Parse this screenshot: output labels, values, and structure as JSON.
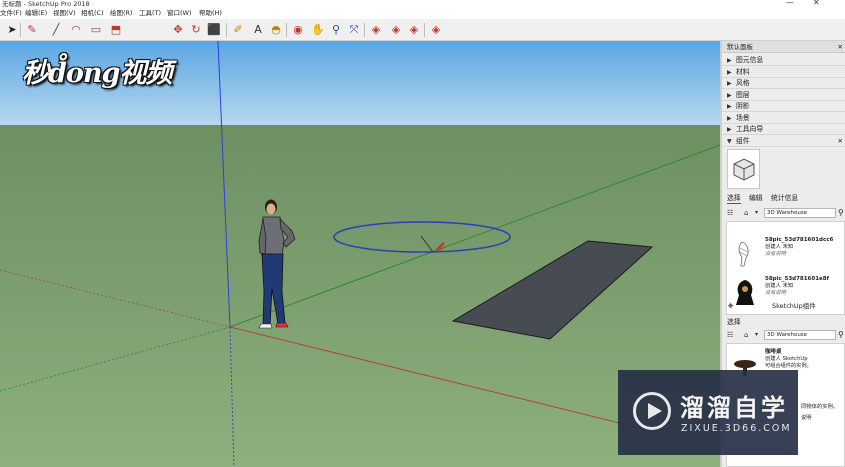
{
  "window": {
    "title": "无标题 - SketchUp Pro 2018",
    "min_glyph": "—",
    "close_glyph": "✕"
  },
  "menu": [
    "文件(F)",
    "编辑(E)",
    "视图(V)",
    "相机(C)",
    "绘图(R)",
    "工具(T)",
    "窗口(W)",
    "帮助(H)"
  ],
  "toolbar": {
    "icons": [
      {
        "name": "select-arrow-icon",
        "glyph": "➤",
        "color": "#222222"
      },
      {
        "name": "eraser-icon",
        "glyph": "✎",
        "color": "#c0392b"
      },
      {
        "name": "line-icon",
        "glyph": "╱",
        "color": "#444444"
      },
      {
        "name": "arc-icon",
        "glyph": "◠",
        "color": "#b03a2e"
      },
      {
        "name": "rectangle-icon",
        "glyph": "▭",
        "color": "#b03a2e"
      },
      {
        "name": "push-pull-icon",
        "glyph": "⬒",
        "color": "#c0392b"
      },
      {
        "name": "move-icon",
        "glyph": "✥",
        "color": "#c0392b"
      },
      {
        "name": "rotate-icon",
        "glyph": "↻",
        "color": "#c0392b"
      },
      {
        "name": "scale-icon",
        "glyph": "⬛",
        "color": "#b03a2e"
      },
      {
        "name": "tape-measure-icon",
        "glyph": "✐",
        "color": "#b8860b"
      },
      {
        "name": "text-icon",
        "glyph": "A",
        "color": "#333333"
      },
      {
        "name": "paint-bucket-icon",
        "glyph": "◓",
        "color": "#b8860b"
      },
      {
        "name": "orbit-icon",
        "glyph": "◉",
        "color": "#c0392b"
      },
      {
        "name": "pan-icon",
        "glyph": "✋",
        "color": "#b8860b"
      },
      {
        "name": "zoom-icon",
        "glyph": "⚲",
        "color": "#1f4f9f"
      },
      {
        "name": "zoom-extents-icon",
        "glyph": "⤧",
        "color": "#1f4f9f"
      },
      {
        "name": "warehouse-icon",
        "glyph": "◈",
        "color": "#c0392b"
      },
      {
        "name": "extension-warehouse-icon",
        "glyph": "◈",
        "color": "#c0392b"
      },
      {
        "name": "share-model-icon",
        "glyph": "◈",
        "color": "#c0392b"
      },
      {
        "name": "extension-manager-icon",
        "glyph": "◈",
        "color": "#c0392b"
      }
    ]
  },
  "watermark": {
    "top_left": "秒d̊ong视频",
    "brand_cn": "溜溜自学",
    "brand_url": "ZIXUE.3D66.COM"
  },
  "colors": {
    "sky": "#6aaee0",
    "ground": "#7b9e6d",
    "axis_red": "#b6402f",
    "axis_green": "#2e8b2e",
    "axis_blue": "#2f3fd8",
    "rectangle_fill": "#474c52"
  },
  "tray": {
    "title": "默认面板",
    "close": "✕",
    "sections": [
      {
        "label": "图元信息",
        "expanded": false
      },
      {
        "label": "材料",
        "expanded": false
      },
      {
        "label": "风格",
        "expanded": false
      },
      {
        "label": "图层",
        "expanded": false
      },
      {
        "label": "阴影",
        "expanded": false
      },
      {
        "label": "场景",
        "expanded": false
      },
      {
        "label": "工具向导",
        "expanded": false
      },
      {
        "label": "组件",
        "expanded": true
      }
    ],
    "arrow_collapsed": "▶",
    "arrow_expanded": "▼",
    "components": {
      "tabs": [
        "选择",
        "编辑",
        "统计信息"
      ],
      "search_placeholder": "3D Warehouse",
      "items": [
        {
          "name": "58pic_53d781601dcc6",
          "by": "创建人 未知",
          "desc": "没有说明"
        },
        {
          "name": "58pic_53d781601e8f",
          "by": "创建人 未知",
          "desc": "没有说明"
        }
      ],
      "footer_link": "SketchUp组件",
      "second_tab": "选择",
      "second_search": "3D Warehouse",
      "second_item": {
        "name": "咖啡桌",
        "by": "创建人 SketchUp",
        "desc": "可组合组件的实例。"
      },
      "second_item_tail": "同物体的实例。",
      "second_item_tail2": "说明"
    }
  }
}
